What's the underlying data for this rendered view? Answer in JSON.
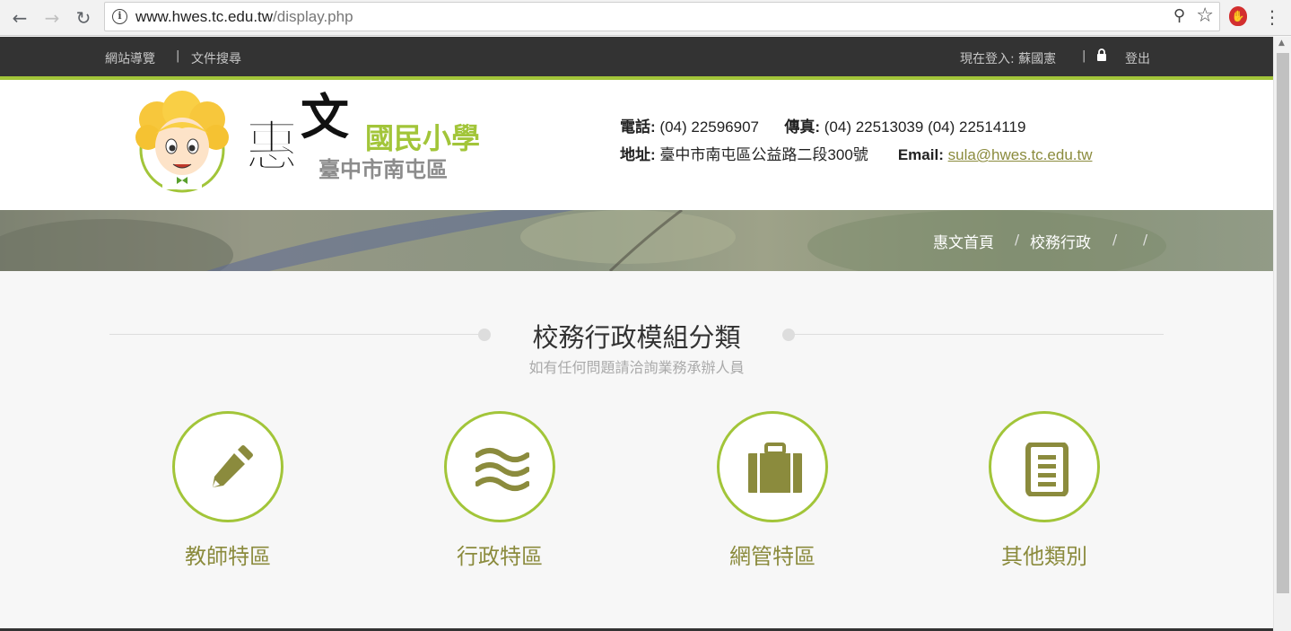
{
  "browser": {
    "url_host": "www.hwes.tc.edu.tw",
    "url_path": "/display.php",
    "back_icon": "arrow-left-icon",
    "forward_icon": "arrow-right-icon",
    "reload_icon": "reload-icon"
  },
  "topbar": {
    "sitemap": "網站導覽",
    "search_docs": "文件搜尋",
    "logged_in": "現在登入: 蘇國憲",
    "logout": "登出"
  },
  "logo": {
    "char1": "惠",
    "char2": "文",
    "school_type": "國民小學",
    "region": "臺中市南屯區"
  },
  "contact": {
    "phone_label": "電話:",
    "phone": "(04) 22596907",
    "fax_label": "傳真:",
    "fax": "(04) 22513039 (04) 22514119",
    "address_label": "地址:",
    "address": "臺中市南屯區公益路二段300號",
    "email_label": "Email:",
    "email": "sula@hwes.tc.edu.tw"
  },
  "breadcrumb": {
    "home": "惠文首頁",
    "section": "校務行政",
    "sep": "/"
  },
  "section": {
    "title": "校務行政模組分類",
    "subtitle": "如有任何問題請洽詢業務承辦人員"
  },
  "categories": [
    {
      "label": "教師特區",
      "icon": "pencil-icon"
    },
    {
      "label": "行政特區",
      "icon": "waves-icon"
    },
    {
      "label": "網管特區",
      "icon": "briefcase-icon"
    },
    {
      "label": "其他類別",
      "icon": "document-icon"
    }
  ],
  "colors": {
    "accent_green": "#a2c539",
    "olive": "#8b8b3d",
    "topbar": "#333333"
  }
}
